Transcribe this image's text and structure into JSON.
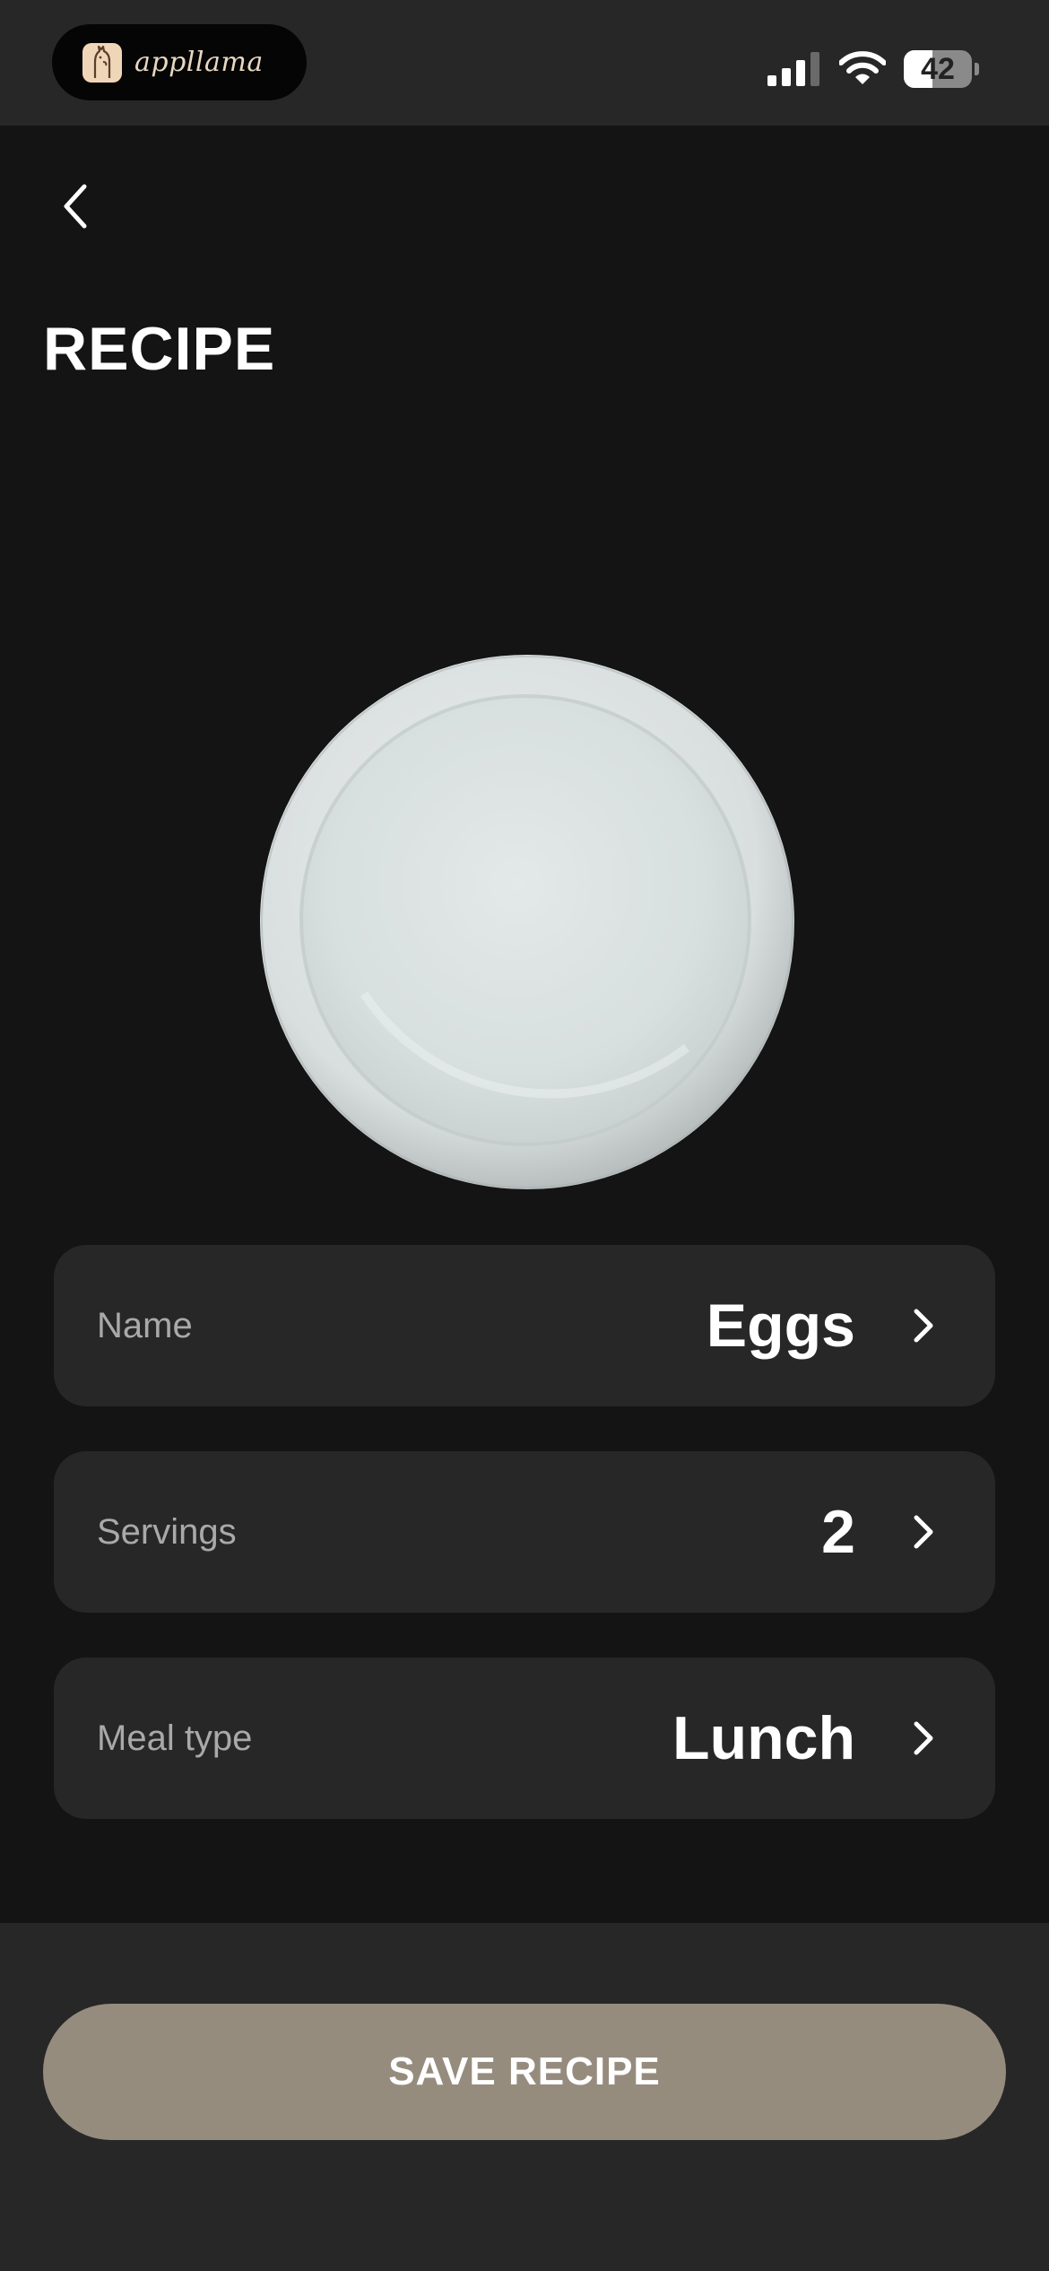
{
  "status_bar": {
    "app_name": "appllama",
    "battery_level": "42",
    "battery_fraction": 0.42
  },
  "header": {
    "title": "RECIPE"
  },
  "fields": [
    {
      "label": "Name",
      "value": "Eggs"
    },
    {
      "label": "Servings",
      "value": "2"
    },
    {
      "label": "Meal type",
      "value": "Lunch"
    }
  ],
  "footer": {
    "save_label": "SAVE RECIPE"
  },
  "icons": {
    "back": "chevron-left-icon",
    "row_chevron": "chevron-right-icon",
    "signal": "cellular-signal-icon",
    "wifi": "wifi-icon",
    "battery": "battery-icon",
    "logo": "llama-logo-icon"
  },
  "colors": {
    "background": "#141414",
    "card": "#272727",
    "accent_button": "#958c7e",
    "label": "#a9a9a9",
    "value": "#ffffff"
  }
}
